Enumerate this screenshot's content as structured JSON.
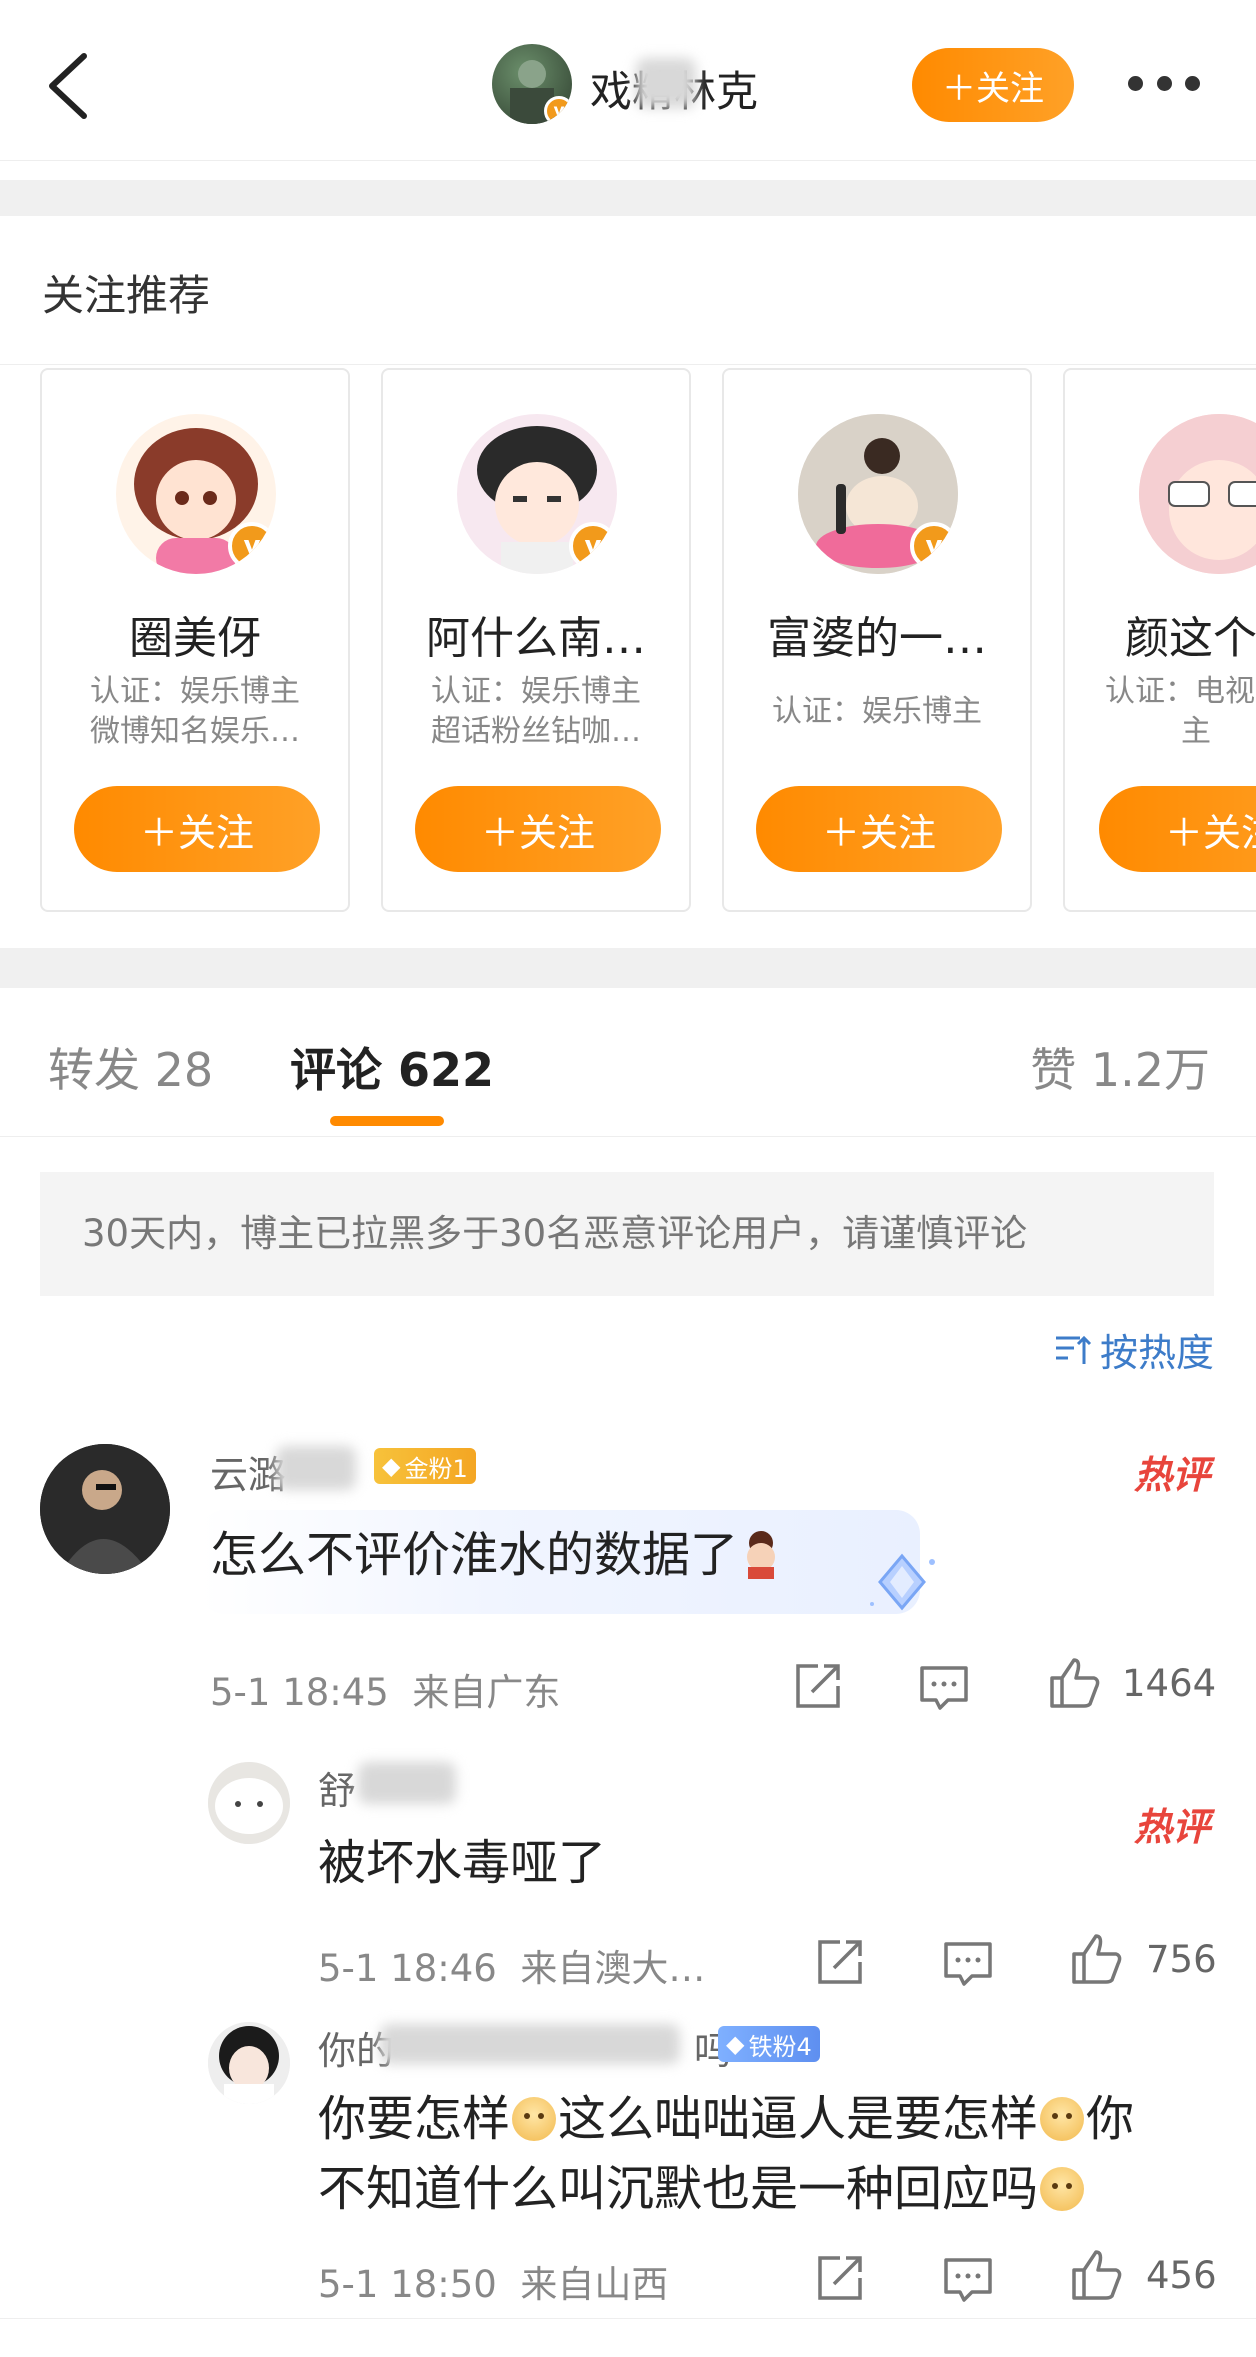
{
  "header": {
    "username": "戏精林克",
    "follow_label": "＋关注"
  },
  "recommend": {
    "title": "关注推荐",
    "cards": [
      {
        "name": "圈美伢",
        "desc_line1": "认证：娱乐博主",
        "desc_line2": "微博知名娱乐…",
        "follow_label": "＋关注"
      },
      {
        "name": "阿什么南…",
        "desc_line1": "认证：娱乐博主",
        "desc_line2": "超话粉丝钻咖…",
        "follow_label": "＋关注"
      },
      {
        "name": "富婆的一…",
        "desc_line1": "认证：娱乐博主",
        "desc_line2": "",
        "follow_label": "＋关注"
      },
      {
        "name": "颜这个",
        "desc_line1": "认证：电视",
        "desc_line2": "主",
        "follow_label": "＋关注"
      }
    ]
  },
  "tabs": [
    {
      "label": "转发 28"
    },
    {
      "label": "评论 622"
    },
    {
      "label": "赞 1.2万"
    }
  ],
  "notice": "30天内，博主已拉黑多于30名恶意评论用户，请谨慎评论",
  "sort_label": "按热度",
  "comments": [
    {
      "name": "云潞",
      "badge": "金粉1",
      "hot": "热评",
      "text": "怎么不评价淮水的数据了",
      "time": "5-1 18:45",
      "location": "来自广东",
      "likes": "1464"
    }
  ],
  "replies": [
    {
      "name": "舒",
      "hot": "热评",
      "text": "被坏水毒哑了",
      "time": "5-1 18:46",
      "location": "来自澳大…",
      "likes": "756"
    },
    {
      "name": "你的",
      "name_tail": "吗",
      "badge": "铁粉4",
      "text_parts": [
        "你要怎样",
        "这么咄咄逼人是要怎样",
        "你",
        "不知道什么叫沉默也是一种回应吗"
      ],
      "time": "5-1 18:50",
      "location": "来自山西",
      "likes": "456"
    }
  ],
  "colors": {
    "accent": "#ff8a00",
    "link": "#3d7cc9",
    "hot": "#e8453c",
    "gold_badge": "#f5b928",
    "iron_badge": "#6a9cf0"
  }
}
